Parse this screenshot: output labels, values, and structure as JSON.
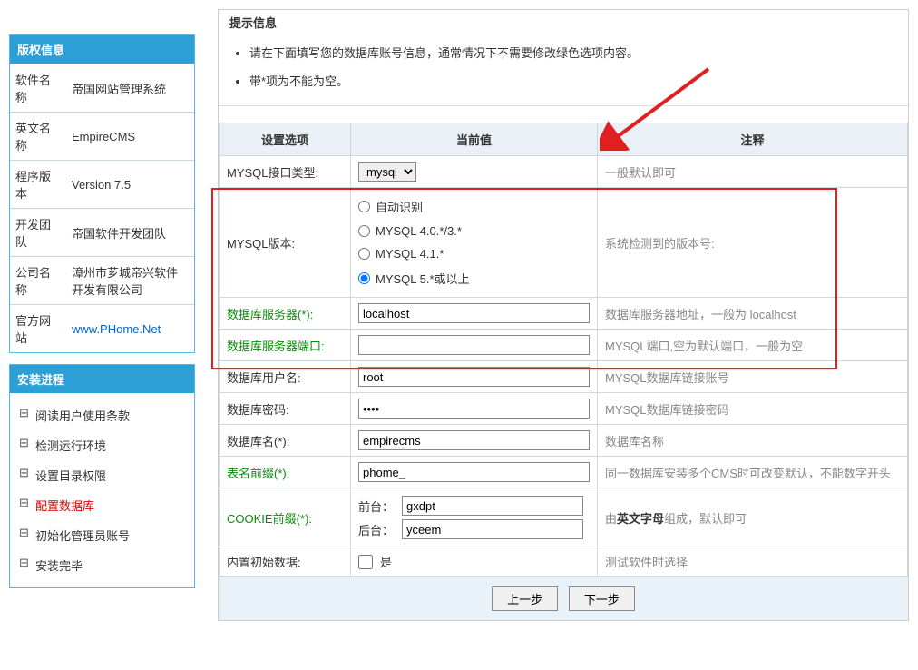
{
  "copyright": {
    "title": "版权信息",
    "rows": [
      {
        "k": "软件名称",
        "v": "帝国网站管理系统"
      },
      {
        "k": "英文名称",
        "v": "EmpireCMS"
      },
      {
        "k": "程序版本",
        "v": "Version 7.5"
      },
      {
        "k": "开发团队",
        "v": "帝国软件开发团队"
      },
      {
        "k": "公司名称",
        "v": "漳州市芗城帝兴软件开发有限公司"
      },
      {
        "k": "官方网站",
        "v": "www.PHome.Net",
        "link": true
      }
    ]
  },
  "progress": {
    "title": "安装进程",
    "items": [
      "阅读用户使用条款",
      "检测运行环境",
      "设置目录权限",
      "配置数据库",
      "初始化管理员账号",
      "安装完毕"
    ],
    "current": 3
  },
  "tips": {
    "title": "提示信息",
    "lines": [
      "请在下面填写您的数据库账号信息，通常情况下不需要修改绿色选项内容。",
      "带*项为不能为空。"
    ]
  },
  "table": {
    "headers": [
      "设置选项",
      "当前值",
      "注释"
    ],
    "mysql_type": {
      "label": "MYSQL接口类型:",
      "value": "mysql",
      "note": "一般默认即可"
    },
    "mysql_ver": {
      "label": "MYSQL版本:",
      "options": [
        "自动识别",
        "MYSQL 4.0.*/3.*",
        "MYSQL 4.1.*",
        "MYSQL 5.*或以上"
      ],
      "selected": 3,
      "note": "系统检测到的版本号:"
    },
    "server": {
      "label": "数据库服务器(*):",
      "value": "localhost",
      "note": "数据库服务器地址，一般为 localhost"
    },
    "port": {
      "label": "数据库服务器端口:",
      "value": "",
      "note": "MYSQL端口,空为默认端口，一般为空"
    },
    "user": {
      "label": "数据库用户名:",
      "value": "root",
      "note": "MYSQL数据库链接账号"
    },
    "pwd": {
      "label": "数据库密码:",
      "value": "••••",
      "note": "MYSQL数据库链接密码"
    },
    "dbname": {
      "label": "数据库名(*):",
      "value": "empirecms",
      "note": "数据库名称"
    },
    "prefix": {
      "label": "表名前缀(*):",
      "value": "phome_",
      "note": "同一数据库安装多个CMS时可改变默认，不能数字开头"
    },
    "cookie": {
      "label": "COOKIE前缀(*):",
      "front_lbl": "前台：",
      "front": "gxdpt",
      "back_lbl": "后台：",
      "back": "yceem",
      "note_pre": "由",
      "note_bold": "英文字母",
      "note_post": "组成，默认即可"
    },
    "initdata": {
      "label": "内置初始数据:",
      "cklabel": "是",
      "note": "测试软件时选择"
    }
  },
  "buttons": {
    "prev": "上一步",
    "next": "下一步"
  }
}
